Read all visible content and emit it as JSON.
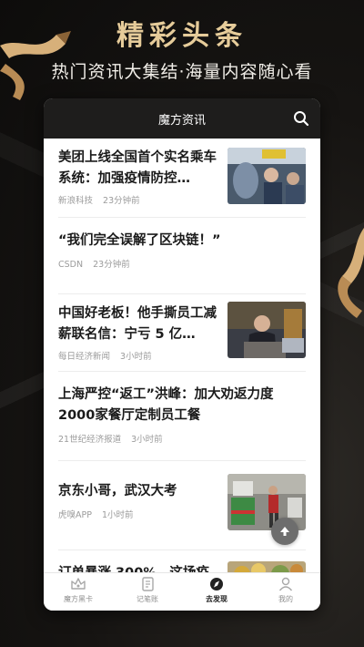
{
  "hero": {
    "title": "精彩头条",
    "subtitle": "热门资讯大集结·海量内容随心看"
  },
  "app": {
    "header_title": "魔方资讯",
    "search_icon": "search-icon"
  },
  "feed": {
    "items": [
      {
        "title": "美团上线全国首个实名乘车系统：加强疫情防控…",
        "source": "新浪科技",
        "time": "23分钟前",
        "has_thumb": true
      },
      {
        "title": "“我们完全误解了区块链！”",
        "source": "CSDN",
        "time": "23分钟前",
        "has_thumb": false
      },
      {
        "title": "中国好老板！他手撕员工减薪联名信：宁亏 5 亿…",
        "source": "每日经济新闻",
        "time": "3小时前",
        "has_thumb": true
      },
      {
        "title": "上海严控“返工”洪峰：加大劝返力度 2000家餐厅定制员工餐",
        "source": "21世纪经济报道",
        "time": "3小时前",
        "has_thumb": false
      },
      {
        "title": "京东小哥，武汉大考",
        "source": "虎嗅APP",
        "time": "1小时前",
        "has_thumb": true
      },
      {
        "title": "订单暴涨 300%，这场疫",
        "source": "",
        "time": "",
        "has_thumb": true
      }
    ]
  },
  "fab": {
    "icon": "arrow-up-icon"
  },
  "tabs": [
    {
      "label": "魔方黑卡",
      "icon": "crown-icon",
      "active": false
    },
    {
      "label": "记笔账",
      "icon": "note-icon",
      "active": false
    },
    {
      "label": "去发现",
      "icon": "compass-icon",
      "active": true
    },
    {
      "label": "我的",
      "icon": "user-icon",
      "active": false
    }
  ],
  "colors": {
    "gold": "#e6cc9a",
    "header_bg": "#1e1d1c",
    "meta_gray": "#9b9b9b"
  }
}
